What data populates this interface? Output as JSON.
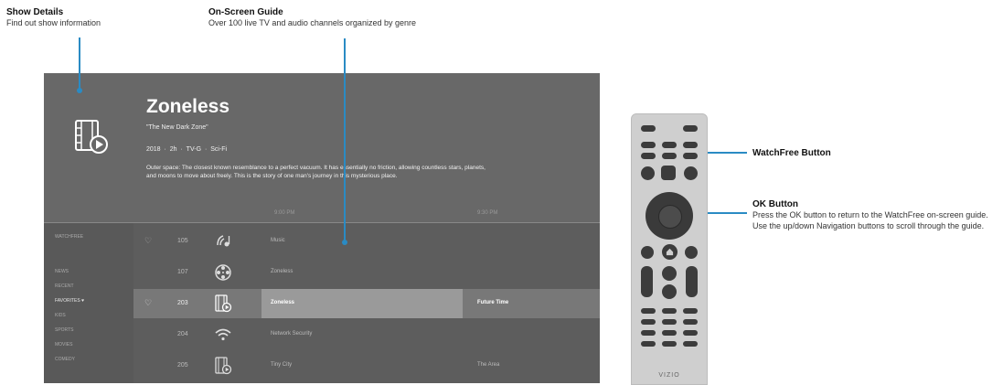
{
  "callouts": {
    "show_details": {
      "title": "Show Details",
      "desc": "Find out show information"
    },
    "guide": {
      "title": "On-Screen Guide",
      "desc": "Over 100 live TV and audio channels organized by genre"
    },
    "watchfree": {
      "title": "WatchFree Button"
    },
    "ok": {
      "title": "OK Button",
      "desc": "Press the OK button to return to the WatchFree on-screen guide. Use the up/down Navigation buttons to scroll through the guide."
    }
  },
  "show": {
    "title": "Zoneless",
    "episode": "\"The New Dark Zone\"",
    "meta": "2018  ·  2h  ·  TV-G  ·  Sci-Fi",
    "synopsis": "Outer space: The closest known resemblance to a perfect vacuum. It has essentially no friction, allowing countless stars, planets, and moons to move about freely. This is the story of one man's journey in this mysterious place."
  },
  "timeline": {
    "t1": "9:00 PM",
    "t2": "9:30 PM"
  },
  "sidebar": [
    {
      "label": "WATCHFREE",
      "selected": false
    },
    {
      "label": "NEWS",
      "selected": false
    },
    {
      "label": "RECENT",
      "selected": false
    },
    {
      "label": "FAVORITES",
      "selected": true
    },
    {
      "label": "KIDS",
      "selected": false
    },
    {
      "label": "SPORTS",
      "selected": false
    },
    {
      "label": "MOVIES",
      "selected": false
    },
    {
      "label": "COMEDY",
      "selected": false
    }
  ],
  "channels": [
    {
      "num": "105",
      "icon": "audio-channel-icon",
      "program": "Music",
      "next": "",
      "selected": false
    },
    {
      "num": "107",
      "icon": "film-reel-icon",
      "program": "Zoneless",
      "next": "",
      "selected": false
    },
    {
      "num": "203",
      "icon": "film-play-icon",
      "program": "Zoneless",
      "next": "Future Time",
      "selected": true
    },
    {
      "num": "204",
      "icon": "wifi-icon",
      "program": "Network Security",
      "next": "",
      "selected": false
    },
    {
      "num": "205",
      "icon": "film-play-icon",
      "program": "Tiny City",
      "next": "The Area",
      "selected": false
    }
  ],
  "remote": {
    "brand": "VIZIO"
  },
  "colors": {
    "leader": "#2a8bc4",
    "screen": "#5d5d5d",
    "remote": "#cfcfcf"
  }
}
